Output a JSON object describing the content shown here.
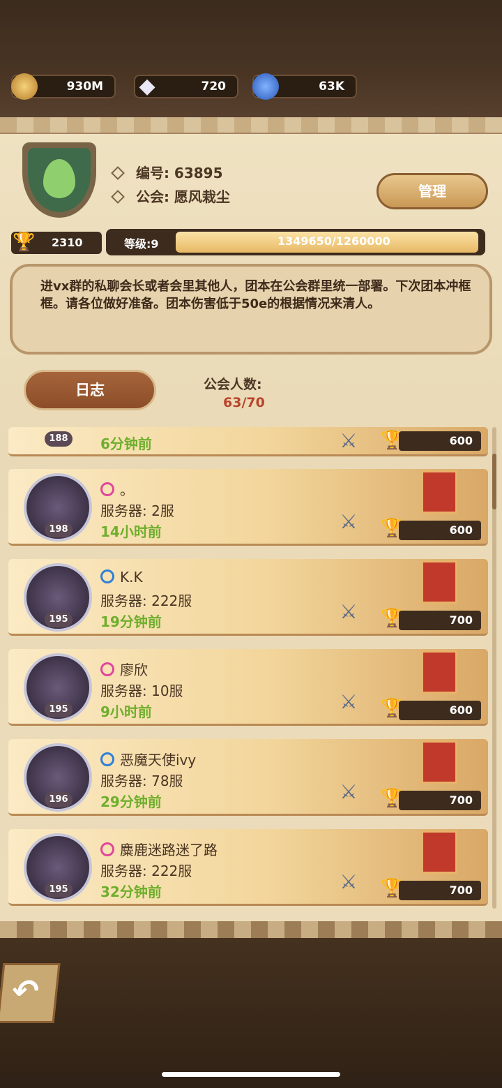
{
  "resources": [
    {
      "icon": "gold-coin-icon",
      "value": "930M"
    },
    {
      "icon": "diamond-icon",
      "value": "720"
    },
    {
      "icon": "blue-gem-icon",
      "value": "63K"
    }
  ],
  "guild": {
    "id_label": "编号: 63895",
    "name_label": "公会: 愿风栽尘",
    "manage_label": "管理",
    "trophy_value": "2310",
    "level_label": "等级:9",
    "exp_text": "1349650/1260000",
    "notice": "进vx群的私聊会长或者会里其他人，团本在公会群里统一部署。下次团本冲框框。请各位做好准备。团本伤害低于50e的根据情况来清人。",
    "log_label": "日志",
    "members_label": "公会人数:",
    "members_value": "63/70"
  },
  "members": [
    {
      "level": "188",
      "name": "",
      "gender": "female",
      "server": "",
      "time": "6分钟前",
      "score": "600"
    },
    {
      "level": "198",
      "name": "。",
      "gender": "female",
      "server": "服务器: 2服",
      "time": "14小时前",
      "score": "600"
    },
    {
      "level": "195",
      "name": "K.K",
      "gender": "male",
      "server": "服务器: 222服",
      "time": "19分钟前",
      "score": "700"
    },
    {
      "level": "195",
      "name": "廖欣",
      "gender": "female",
      "server": "服务器: 10服",
      "time": "9小时前",
      "score": "600"
    },
    {
      "level": "196",
      "name": "恶魔天使ivy",
      "gender": "male",
      "server": "服务器: 78服",
      "time": "29分钟前",
      "score": "700"
    },
    {
      "level": "195",
      "name": "麋鹿迷路迷了路",
      "gender": "female",
      "server": "服务器: 222服",
      "time": "32分钟前",
      "score": "700"
    }
  ],
  "colors": {
    "female": "#e0479a",
    "male": "#2f7fd6",
    "online_time": "#6fae2d"
  }
}
